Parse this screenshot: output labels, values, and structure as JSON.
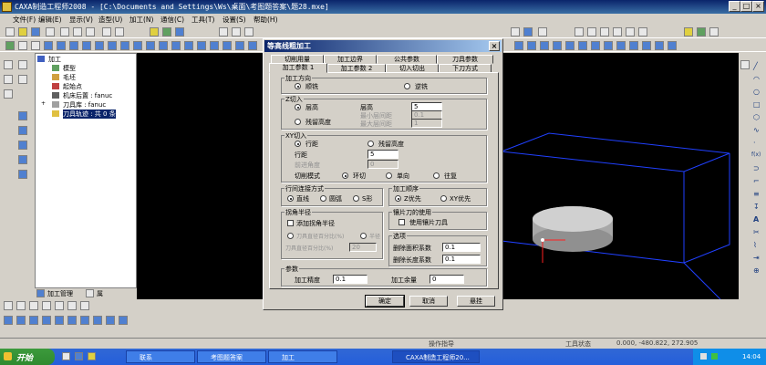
{
  "window": {
    "title": "CAXA制造工程师2008 - [C:\\Documents and Settings\\Ws\\桌面\\考图题答案\\题28.mxe]"
  },
  "menu": [
    "文件(F)",
    "编辑(E)",
    "显示(V)",
    "造型(U)",
    "加工(N)",
    "通信(C)",
    "工具(T)",
    "设置(S)",
    "帮助(H)"
  ],
  "tree": {
    "items": [
      {
        "label": "加工"
      },
      {
        "label": "模型"
      },
      {
        "label": "毛坯"
      },
      {
        "label": "起始点"
      },
      {
        "label": "机床后置 : fanuc"
      },
      {
        "label": "刀具库 : fanuc"
      },
      {
        "label": "刀具轨迹 : 共 0 条"
      }
    ],
    "tabs": [
      "加工管理",
      "属"
    ]
  },
  "dialog": {
    "title": "等高线粗加工",
    "tabs_row1": [
      "切削用量",
      "加工边界",
      "公共参数",
      "刀具参数"
    ],
    "tabs_row2": [
      "加工参数 1",
      "加工参数 2",
      "切入切出",
      "下刀方式"
    ],
    "direction": {
      "title": "加工方向",
      "opt1": "顺铣",
      "opt2": "逆铣"
    },
    "z_cut": {
      "title": "Z切入",
      "layer_height": "层高",
      "residual_height": "残留高度",
      "height_label": "层高",
      "height_value": "5",
      "min_label": "最小层间距",
      "min_value": "0.1",
      "max_label": "最大层间距",
      "max_value": "1"
    },
    "xy_cut": {
      "title": "XY切入",
      "row_spacing": "行距",
      "residual_height": "残留高度",
      "spacing_label": "行距",
      "spacing_value": "5",
      "angle_label": "前进角度",
      "angle_value": "0",
      "mode_label": "切削模式",
      "mode1": "环切",
      "mode2": "单向",
      "mode3": "往复"
    },
    "connect": {
      "title": "行间连接方式",
      "opt1": "直线",
      "opt2": "圆弧",
      "opt3": "S形"
    },
    "order": {
      "title": "加工顺序",
      "opt1": "Z优先",
      "opt2": "XY优先"
    },
    "corner": {
      "title": "拐角半径",
      "add_label": "添加拐角半径",
      "percent_label": "刀具直径百分比(%)",
      "radius_label": "半径",
      "percent_field_label": "刀具直径百分比(%)",
      "percent_value": "20"
    },
    "insert": {
      "title": "镶片刀的使用",
      "label": "使用镶片刀具"
    },
    "options": {
      "title": "选项",
      "min_area_label": "删除面积系数",
      "min_area_value": "0.1",
      "min_len_label": "删除长度系数",
      "min_len_value": "0.1"
    },
    "params": {
      "title": "参数",
      "precision_label": "加工精度",
      "precision_value": "0.1",
      "allowance_label": "加工余量",
      "allowance_value": "0"
    },
    "buttons": {
      "ok": "确定",
      "cancel": "取消",
      "hang": "悬挂"
    }
  },
  "status": {
    "prompt": "操作指导",
    "tool_state": "工具状态",
    "coords": "0.000, -480.822, 272.905"
  },
  "taskbar": {
    "start": "开始",
    "tasks": [
      "联系",
      "考图题答案",
      "加工",
      "CAXA制造工程师20..."
    ],
    "time": "14:04"
  },
  "colors": {
    "title_bar": "#0a246a",
    "viewport_bg": "#000000",
    "taskbar": "#245edb",
    "start": "#3c9a3c"
  }
}
